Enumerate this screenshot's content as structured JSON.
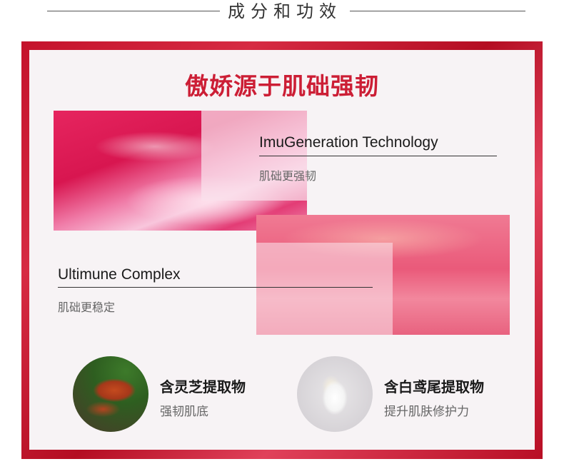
{
  "header": {
    "title": "成分和功效"
  },
  "main": {
    "title": "傲娇源于肌础强韧"
  },
  "ingredients": [
    {
      "name_en": "ImuGeneration Technology",
      "desc": "肌础更强韧"
    },
    {
      "name_en": "Ultimune Complex",
      "desc": "肌础更稳定"
    }
  ],
  "extracts": [
    {
      "name": "含灵芝提取物",
      "desc": "强韧肌底",
      "icon": "reishi-mushroom-image"
    },
    {
      "name": "含白鸢尾提取物",
      "desc": "提升肌肤修护力",
      "icon": "white-iris-image"
    }
  ],
  "colors": {
    "accent": "#cc1e35",
    "frame": "#c4122b"
  }
}
